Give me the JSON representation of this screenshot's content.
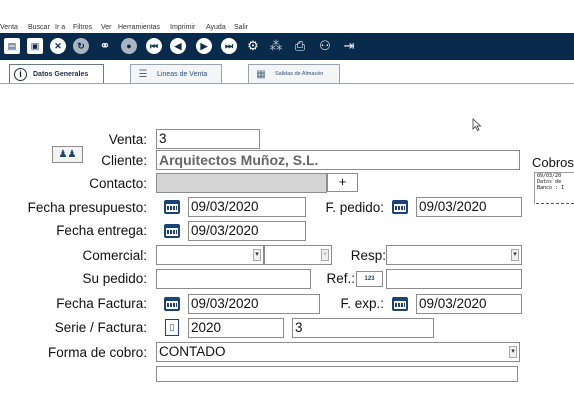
{
  "menu": [
    "Venta",
    "Buscar",
    "Ir a",
    "Filtros",
    "Ver",
    "Herramientas",
    "Imprimir",
    "Ayuda",
    "Salir"
  ],
  "toolbar": {
    "icons": [
      "document-icon",
      "save-icon",
      "close-circle-icon",
      "refresh-icon",
      "binoculars-icon",
      "settings-icon",
      "first-icon",
      "previous-icon",
      "next-icon",
      "last-icon",
      "gear-icon",
      "network-icon",
      "print-icon",
      "user-icon",
      "exit-icon"
    ]
  },
  "tabs": [
    {
      "label": "Datos Generales",
      "icon": "info-icon",
      "active": true
    },
    {
      "label": "Lineas de Venta",
      "icon": "lines-icon",
      "active": false
    },
    {
      "label": "Salidas de Almacén",
      "icon": "warehouse-icon",
      "active": false
    }
  ],
  "form": {
    "venta": {
      "label": "Venta:",
      "value": "3"
    },
    "cliente": {
      "label": "Cliente:",
      "value": "Arquitectos Muñoz, S.L."
    },
    "contacto": {
      "label": "Contacto:",
      "value": "",
      "add_label": "+"
    },
    "fecha_presupuesto": {
      "label": "Fecha presupuesto:",
      "value": "09/03/2020"
    },
    "f_pedido": {
      "label": "F. pedido:",
      "value": "09/03/2020"
    },
    "fecha_entrega": {
      "label": "Fecha entrega:",
      "value": "09/03/2020"
    },
    "comercial": {
      "label": "Comercial:",
      "value": ""
    },
    "resp": {
      "label": "Resp:",
      "value": ""
    },
    "su_pedido": {
      "label": "Su pedido:",
      "value": ""
    },
    "ref": {
      "label": "Ref.:",
      "badge": "123",
      "value": ""
    },
    "fecha_factura": {
      "label": "Fecha Factura:",
      "value": "09/03/2020"
    },
    "f_exp": {
      "label": "F. exp.:",
      "value": "09/03/2020"
    },
    "serie_factura": {
      "label": "Serie / Factura:",
      "serie": "2020",
      "factura": "3"
    },
    "forma_cobro": {
      "label": "Forma de cobro:",
      "value": "CONTADO"
    }
  },
  "cobros": {
    "title": "Cobros",
    "lines": [
      "09/03/20",
      "Datos de",
      "Banco : I"
    ]
  }
}
